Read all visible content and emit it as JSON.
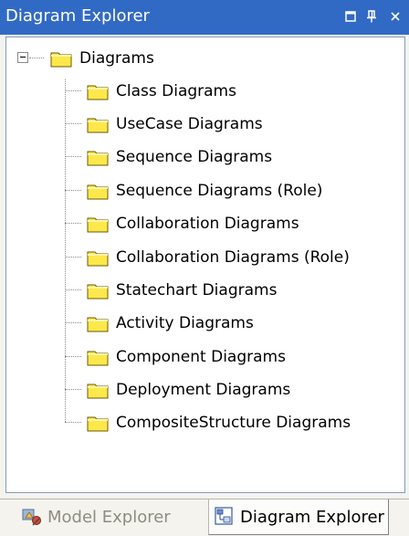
{
  "window": {
    "title": "Diagram Explorer",
    "controls": {
      "float_glyph": "□",
      "pin_glyph": "ᵽ",
      "close_glyph": "×"
    }
  },
  "tree": {
    "root": {
      "label": "Diagrams",
      "icon": "folder-icon",
      "expanded": true,
      "expander_icon": "collapse-minus-icon"
    },
    "children": [
      {
        "label": "Class Diagrams"
      },
      {
        "label": "UseCase Diagrams"
      },
      {
        "label": "Sequence Diagrams"
      },
      {
        "label": "Sequence Diagrams (Role)"
      },
      {
        "label": "Collaboration Diagrams"
      },
      {
        "label": "Collaboration Diagrams (Role)"
      },
      {
        "label": "Statechart Diagrams"
      },
      {
        "label": "Activity Diagrams"
      },
      {
        "label": "Component Diagrams"
      },
      {
        "label": "Deployment Diagrams"
      },
      {
        "label": "CompositeStructure Diagrams"
      }
    ]
  },
  "tabs": [
    {
      "label": "Model Explorer",
      "icon": "model-explorer-icon",
      "active": false
    },
    {
      "label": "Diagram Explorer",
      "icon": "diagram-explorer-icon",
      "active": true
    }
  ],
  "colors": {
    "titlebar": "#316ac5",
    "folder_fill": "#fde84b",
    "folder_stroke": "#6a5a00",
    "panel_bg": "#f4f3ee"
  }
}
